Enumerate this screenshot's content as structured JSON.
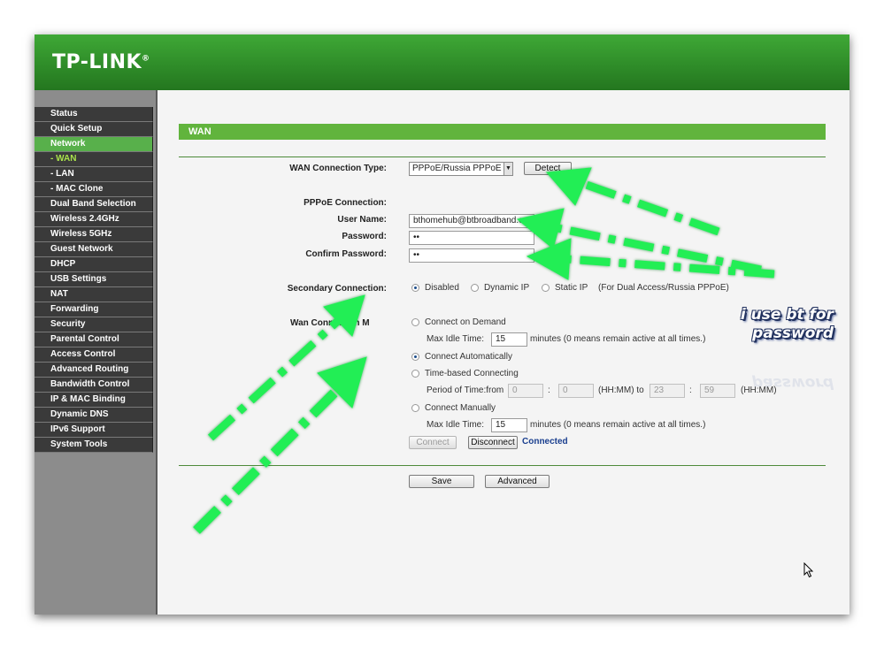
{
  "brand": {
    "logo": "TP-LINK",
    "mark": "®"
  },
  "sidebar": {
    "items": [
      {
        "label": "Status"
      },
      {
        "label": "Quick Setup"
      },
      {
        "label": "Network"
      },
      {
        "label": "- WAN"
      },
      {
        "label": "- LAN"
      },
      {
        "label": "- MAC Clone"
      },
      {
        "label": "Dual Band Selection"
      },
      {
        "label": "Wireless 2.4GHz"
      },
      {
        "label": "Wireless 5GHz"
      },
      {
        "label": "Guest Network"
      },
      {
        "label": "DHCP"
      },
      {
        "label": "USB Settings"
      },
      {
        "label": "NAT"
      },
      {
        "label": "Forwarding"
      },
      {
        "label": "Security"
      },
      {
        "label": "Parental Control"
      },
      {
        "label": "Access Control"
      },
      {
        "label": "Advanced Routing"
      },
      {
        "label": "Bandwidth Control"
      },
      {
        "label": "IP & MAC Binding"
      },
      {
        "label": "Dynamic DNS"
      },
      {
        "label": "IPv6 Support"
      },
      {
        "label": "System Tools"
      }
    ],
    "active_index": 2,
    "active_sub_index": 3
  },
  "page": {
    "title": "WAN",
    "wan_type": {
      "label": "WAN Connection Type:",
      "value": "PPPoE/Russia PPPoE",
      "detect": "Detect"
    },
    "pppoe": {
      "heading": "PPPoE Connection:",
      "user_label": "User Name:",
      "user_value": "bthomehub@btbroadband.cc",
      "password_label": "Password:",
      "password_value": "••",
      "confirm_label": "Confirm Password:",
      "confirm_value": "••"
    },
    "secondary": {
      "label": "Secondary Connection:",
      "disabled": "Disabled",
      "dynamic_ip": "Dynamic IP",
      "static_ip": "Static IP",
      "note": "(For Dual Access/Russia PPPoE)"
    },
    "mode": {
      "label": "Wan Connection M",
      "on_demand": "Connect on Demand",
      "max_idle_label": "Max Idle Time:",
      "max_idle_value": "15",
      "max_idle_note": "minutes (0 means remain active at all times.)",
      "automatic": "Connect Automatically",
      "time_based": "Time-based Connecting",
      "period_label": "Period of Time:from",
      "from_h": "0",
      "from_m": "0",
      "hhmm_to": "(HH:MM) to",
      "to_h": "23",
      "to_m": "59",
      "hhmm": "(HH:MM)",
      "colon": ":",
      "manual": "Connect Manually",
      "max_idle_label2": "Max Idle Time:",
      "max_idle_value2": "15",
      "max_idle_note2": "minutes (0 means remain active at all times.)",
      "connect_btn": "Connect",
      "disconnect_btn": "Disconnect",
      "status": "Connected"
    },
    "save": "Save",
    "advanced": "Advanced"
  },
  "annotation": {
    "text_line1": "i use bt for",
    "text_line2": "password",
    "arrow_color": "#22ee55"
  },
  "colors": {
    "brand_green": "#2f8d29",
    "bar_green": "#61b43d",
    "menu_dark": "#3a3a3a",
    "menu_active": "#58b04b"
  }
}
